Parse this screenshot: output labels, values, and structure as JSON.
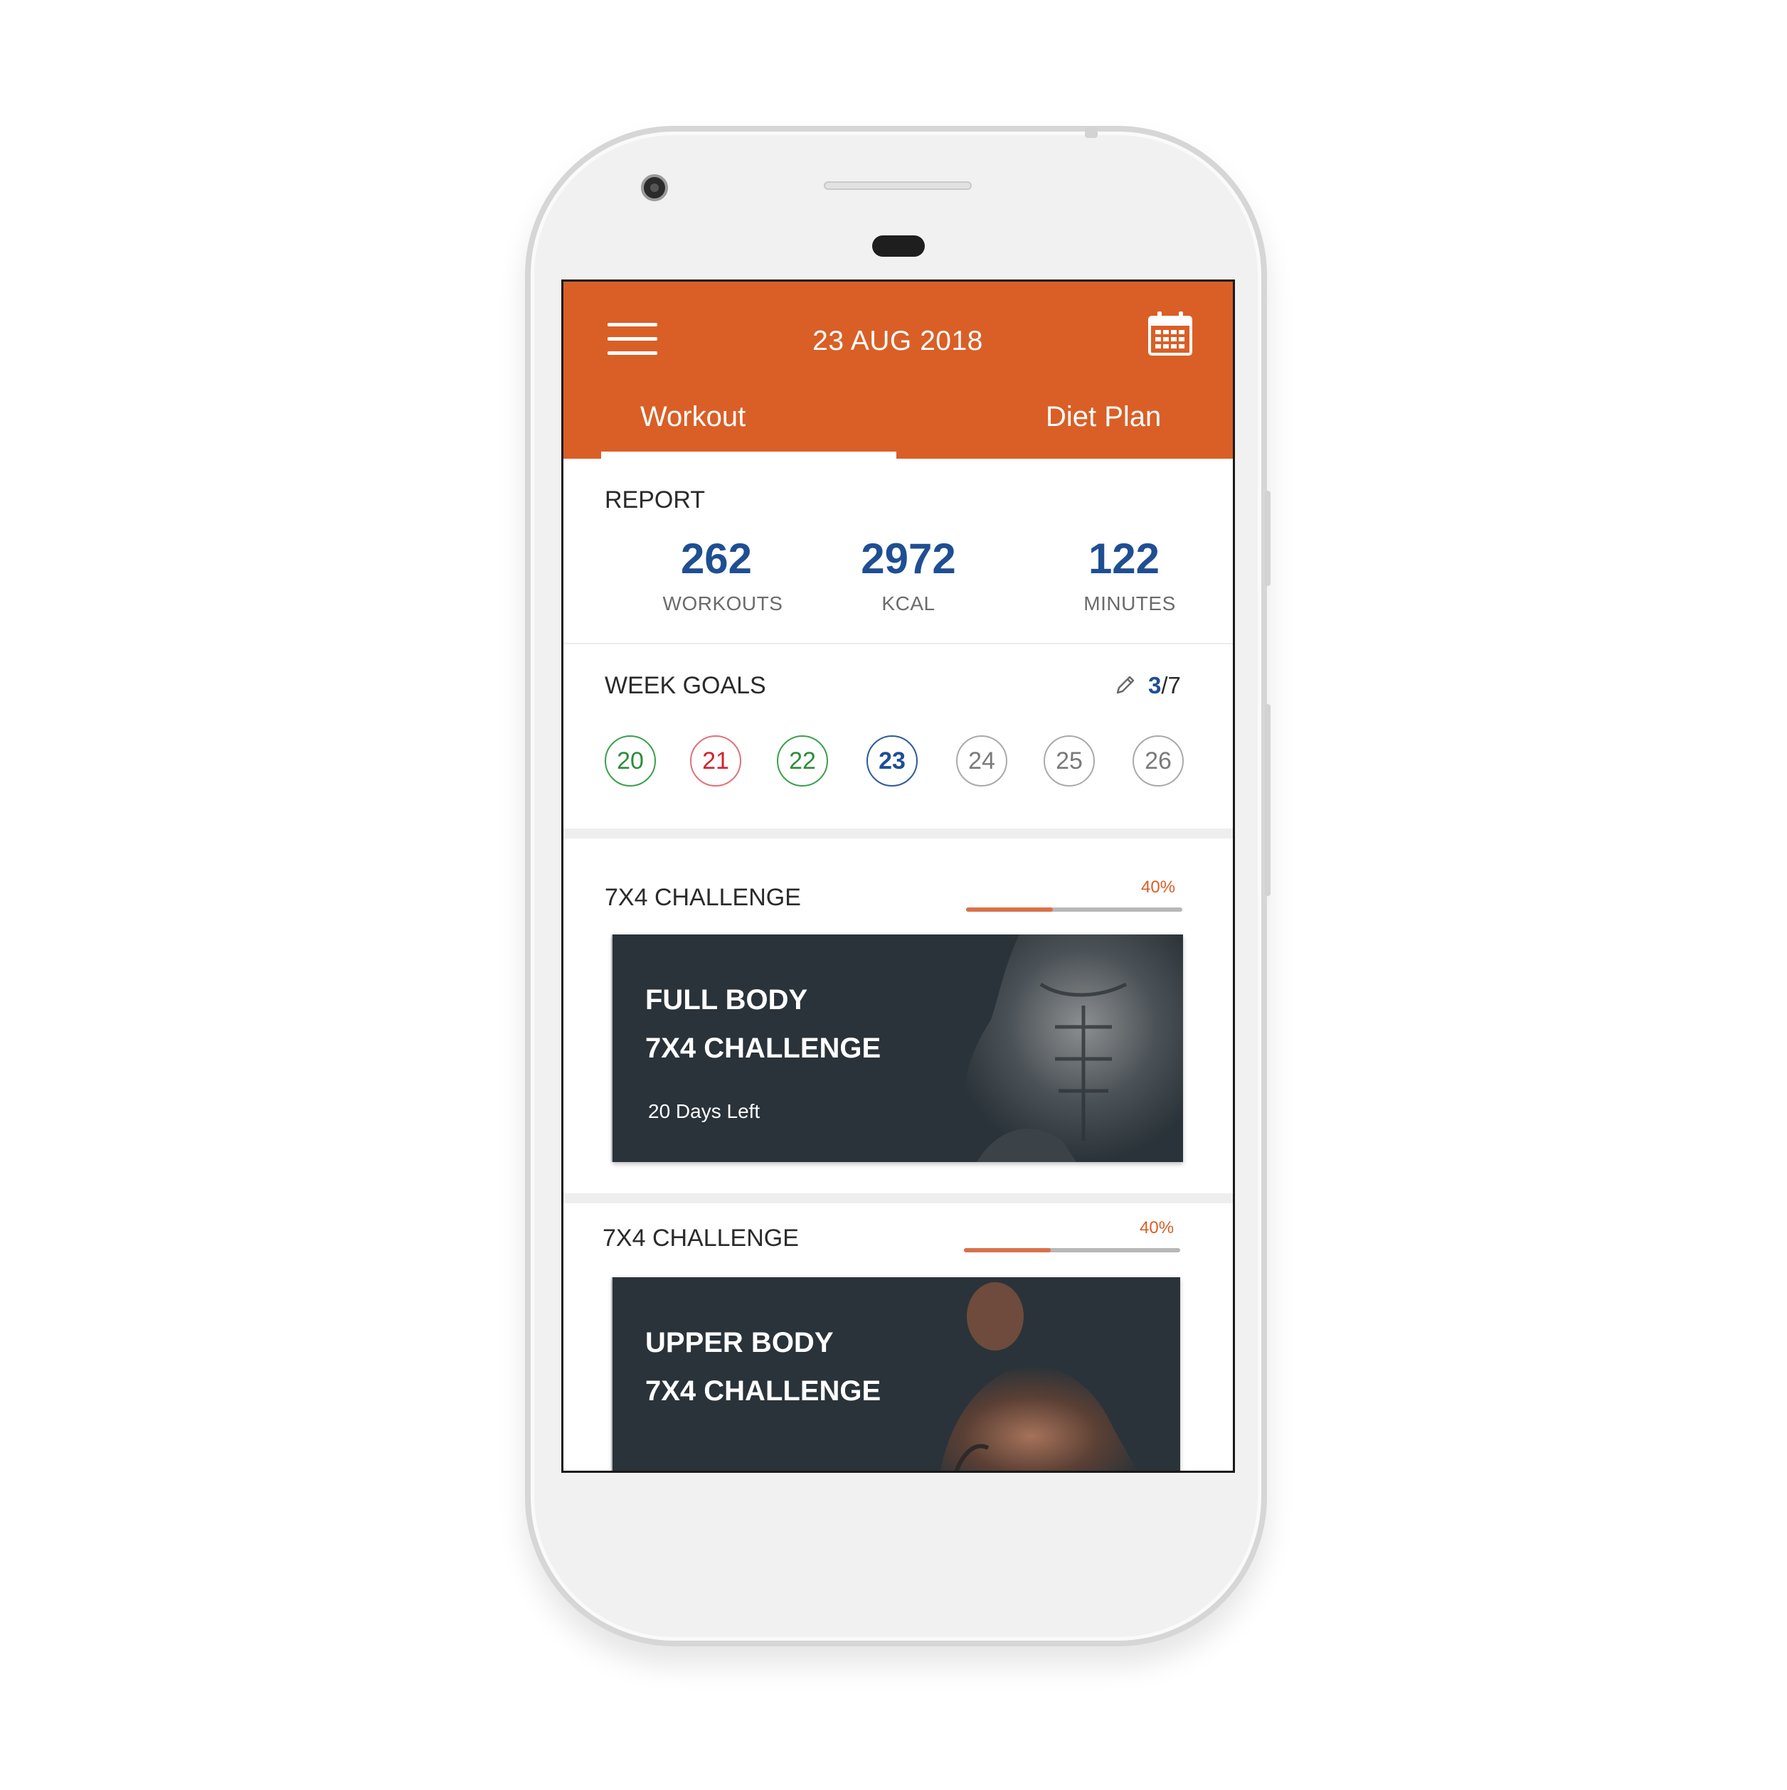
{
  "header": {
    "date": "23 AUG 2018",
    "menu_icon": "menu-icon",
    "calendar_icon": "calendar-icon"
  },
  "tabs": [
    {
      "label": "Workout",
      "active": true
    },
    {
      "label": "Diet Plan",
      "active": false
    }
  ],
  "report": {
    "title": "REPORT",
    "stats": [
      {
        "value": "262",
        "label": "WORKOUTS"
      },
      {
        "value": "2972",
        "label": "KCAL"
      },
      {
        "value": "122",
        "label": "MINUTES"
      }
    ]
  },
  "week_goals": {
    "title": "WEEK GOALS",
    "done": "3",
    "separator": "/",
    "total": "7",
    "days": [
      {
        "day": "20",
        "status": "done"
      },
      {
        "day": "21",
        "status": "missed"
      },
      {
        "day": "22",
        "status": "done"
      },
      {
        "day": "23",
        "status": "today"
      },
      {
        "day": "24",
        "status": "upcoming"
      },
      {
        "day": "25",
        "status": "upcoming"
      },
      {
        "day": "26",
        "status": "upcoming"
      }
    ]
  },
  "challenges": [
    {
      "section_title": "7X4 CHALLENGE",
      "progress_label": "40%",
      "progress": 0.4,
      "card_title_1": "FULL BODY",
      "card_title_2": "7X4 CHALLENGE",
      "card_sub": "20 Days Left"
    },
    {
      "section_title": "7X4 CHALLENGE",
      "progress_label": "40%",
      "progress": 0.4,
      "card_title_1": "UPPER BODY",
      "card_title_2": "7X4 CHALLENGE"
    }
  ],
  "colors": {
    "accent": "#d95f27",
    "stat_blue": "#1f4e93",
    "done_green": "#2e8c3c",
    "missed_red": "#d3222f",
    "card_bg": "#2a3339"
  }
}
